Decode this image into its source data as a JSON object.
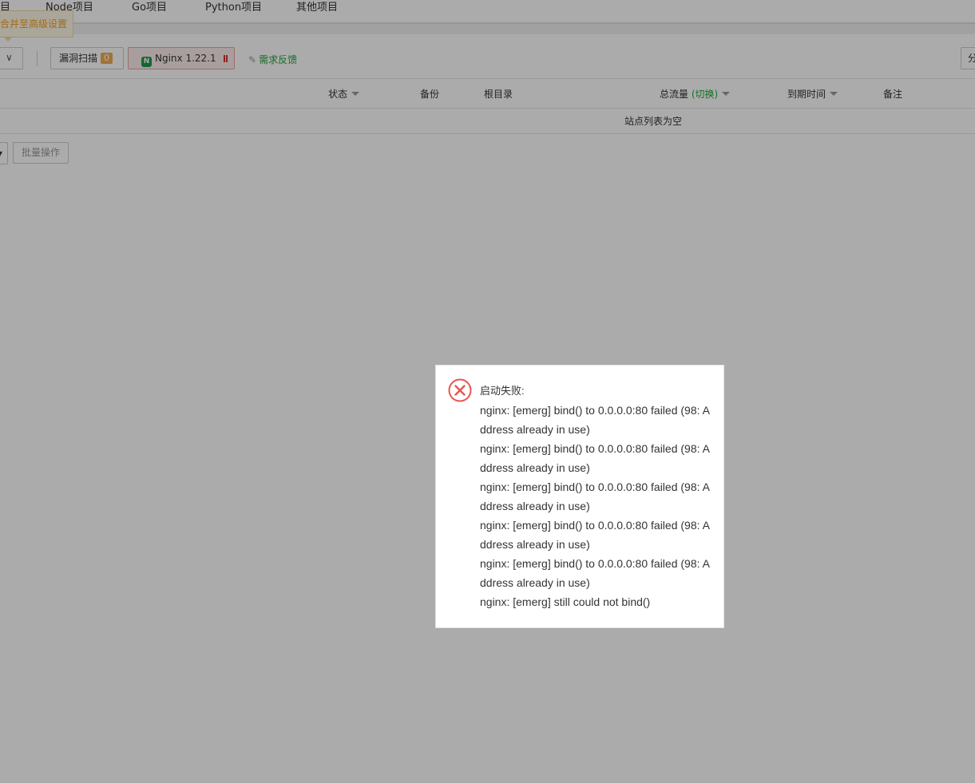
{
  "tabs": [
    "目",
    "Node项目",
    "Go项目",
    "Python项目",
    "其他项目"
  ],
  "tooltip": "合并至高级设置",
  "toolbar": {
    "select_caret": "∨",
    "vuln_scan_label": "漏洞扫描",
    "vuln_count": "0",
    "nginx_label": "Nginx 1.22.1",
    "feedback_label": "需求反馈",
    "right_partial": "分"
  },
  "table": {
    "headers": {
      "status": "状态",
      "backup": "备份",
      "root": "根目录",
      "traffic": "总流量",
      "traffic_switch": "(切换)",
      "expire": "到期时间",
      "note": "备注"
    },
    "empty_text": "站点列表为空"
  },
  "bulk_action_label": "批量操作",
  "dialog": {
    "title": "启动失败:",
    "lines": [
      "nginx: [emerg] bind() to 0.0.0.0:80 failed (98: Address already in use)",
      "nginx: [emerg] bind() to 0.0.0.0:80 failed (98: Address already in use)",
      "nginx: [emerg] bind() to 0.0.0.0:80 failed (98: Address already in use)",
      "nginx: [emerg] bind() to 0.0.0.0:80 failed (98: Address already in use)",
      "nginx: [emerg] bind() to 0.0.0.0:80 failed (98: Address already in use)",
      "nginx: [emerg] still could not bind()"
    ]
  },
  "colors": {
    "overlay": "#a9a9a9",
    "accent_green": "#20a53a",
    "error_red": "#e8554e",
    "badge_orange": "#f0ad4e"
  }
}
